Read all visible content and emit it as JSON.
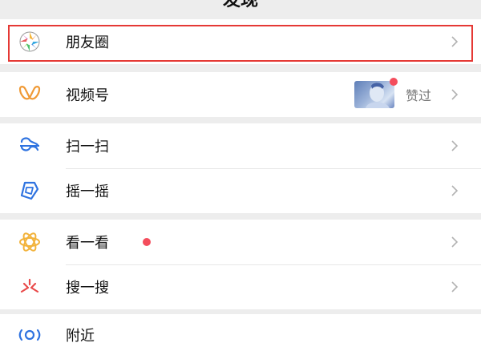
{
  "header": {
    "title": "发现"
  },
  "items": [
    {
      "id": "moments",
      "label": "朋友圈",
      "icon": "moments-icon"
    },
    {
      "id": "channels",
      "label": "视频号",
      "icon": "channels-icon",
      "side_text": "赞过",
      "has_thumbnail": true,
      "thumbnail_badge": true
    },
    {
      "id": "scan",
      "label": "扫一扫",
      "icon": "scan-icon"
    },
    {
      "id": "shake",
      "label": "摇一摇",
      "icon": "shake-icon"
    },
    {
      "id": "top-stories",
      "label": "看一看",
      "icon": "top-stories-icon",
      "badge": "red-dot"
    },
    {
      "id": "search",
      "label": "搜一搜",
      "icon": "search-icon"
    },
    {
      "id": "nearby",
      "label": "附近",
      "icon": "nearby-icon"
    }
  ],
  "colors": {
    "background": "#ededed",
    "highlight_border": "#e53935",
    "badge_red": "#f44d5c",
    "chevron": "#b2b2b2"
  }
}
